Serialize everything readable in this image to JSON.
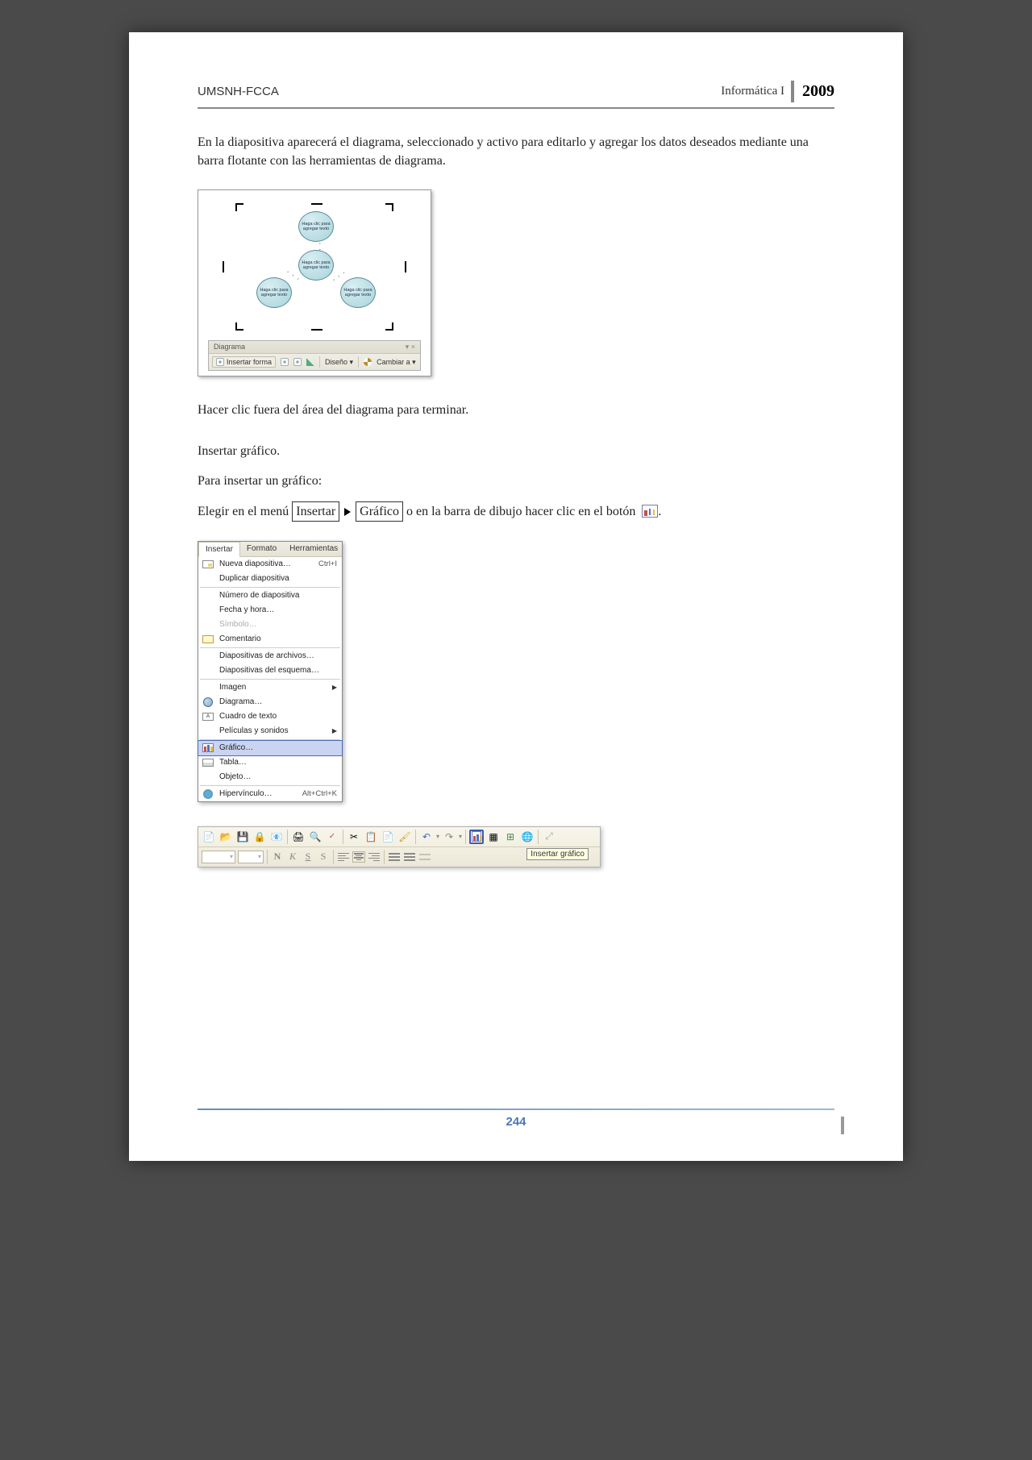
{
  "header": {
    "org": "UMSNH-FCCA",
    "course": "Informática I",
    "year": "2009"
  },
  "paragraph1": "En la diapositiva aparecerá el diagrama, seleccionado y activo para editarlo y agregar los datos deseados mediante una barra flotante con las herramientas de diagrama.",
  "diagram": {
    "bubble_text": "Haga clic para agregar texto",
    "toolbar": {
      "title": "Diagrama",
      "insert_shape": "Insertar forma",
      "layout": "Diseño",
      "change": "Cambiar a"
    }
  },
  "paragraph2": "Hacer clic fuera del área del diagrama para terminar.",
  "section_title": "Insertar gráfico.",
  "paragraph3": "Para insertar un gráfico:",
  "instruction": {
    "pre": "Elegir en el menú",
    "box1": "Insertar",
    "box2": "Gráfico",
    "post": "o en la barra de dibujo hacer clic en el botón"
  },
  "menu": {
    "tab_insertar": "Insertar",
    "tab_formato": "Formato",
    "tab_herramientas": "Herramientas",
    "items": {
      "nueva": "Nueva diapositiva…",
      "nueva_sc": "Ctrl+I",
      "duplicar": "Duplicar diapositiva",
      "numero": "Número de diapositiva",
      "fecha": "Fecha y hora…",
      "simbolo": "Símbolo…",
      "comentario": "Comentario",
      "archivos": "Diapositivas de archivos…",
      "esquema": "Diapositivas del esquema…",
      "imagen": "Imagen",
      "diagrama": "Diagrama…",
      "cuadro": "Cuadro de texto",
      "peliculas": "Películas y sonidos",
      "grafico": "Gráfico…",
      "tabla": "Tabla…",
      "objeto": "Objeto…",
      "hyper": "Hipervínculo…",
      "hyper_sc": "Alt+Ctrl+K"
    }
  },
  "toolbar_tooltip": "Insertar gráfico",
  "format_letters": {
    "n": "N",
    "k": "K",
    "s": "S",
    "s2": "S"
  },
  "page_number": "244"
}
